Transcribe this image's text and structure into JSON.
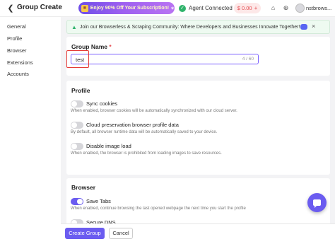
{
  "header": {
    "title": "Group Create",
    "promo_text": "Enjoy 90% Off Your Subscription!",
    "agent_status": "Agent Connected",
    "balance": "$ 0.00",
    "username": "nstbrows..."
  },
  "sidebar": {
    "items": [
      {
        "label": "General"
      },
      {
        "label": "Profile"
      },
      {
        "label": "Browser"
      },
      {
        "label": "Extensions"
      },
      {
        "label": "Accounts"
      }
    ]
  },
  "notice": {
    "text": "Join our Browserless & Scraping Community: Where Developers and Businesses Innovate Together!"
  },
  "group_name": {
    "label": "Group Name",
    "required_mark": "*",
    "value": "test",
    "counter": "4 / 60"
  },
  "profile": {
    "title": "Profile",
    "options": [
      {
        "label": "Sync cookies",
        "description": "When enabled, browser cookies will be automatically synchronized with our cloud server.",
        "enabled": false
      },
      {
        "label": "Cloud preservation browser profile data",
        "description": "By default, all browser runtime data will be automatically saved to your device.",
        "enabled": false
      },
      {
        "label": "Disable image load",
        "description": "When enabled, the browser is prohibited from loading images to save resources.",
        "enabled": false
      }
    ]
  },
  "browser": {
    "title": "Browser",
    "options": [
      {
        "label": "Save Tabs",
        "description": "When enabled, continue browsing the last opened webpage the next time you start the profile",
        "enabled": true
      },
      {
        "label": "Secure DNS",
        "enabled": false
      }
    ]
  },
  "footer": {
    "create_label": "Create Group",
    "cancel_label": "Cancel"
  },
  "colors": {
    "accent": "#6b5cf0",
    "highlight": "#e53935",
    "success": "#2fb36b"
  }
}
